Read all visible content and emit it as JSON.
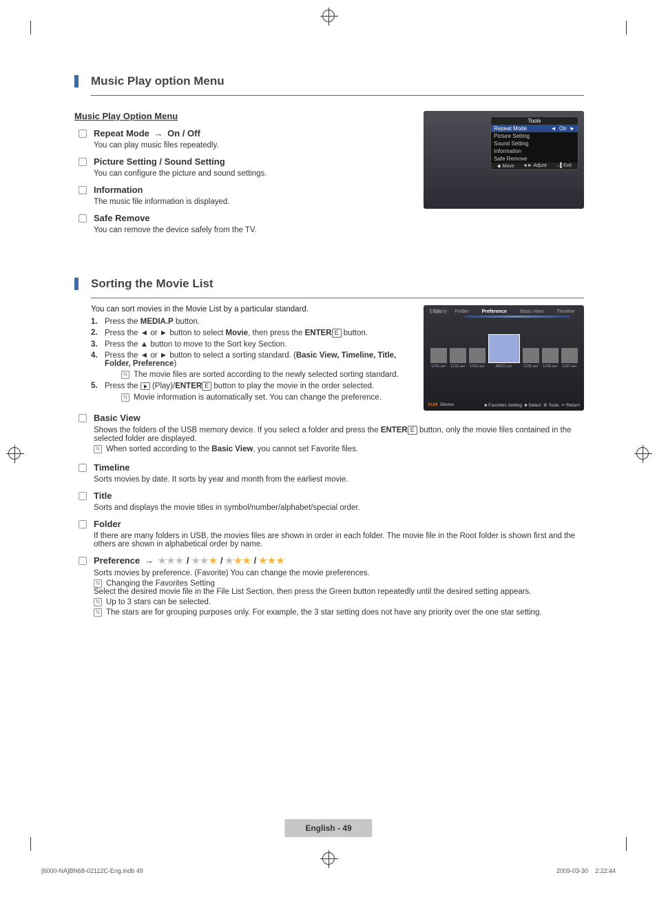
{
  "section1": {
    "heading": "Music Play option Menu",
    "subheading": "Music Play Option Menu",
    "items": [
      {
        "title_a": "Repeat Mode",
        "title_b": "On / Off",
        "desc": "You can play music files repeatedly."
      },
      {
        "title_a": "Picture Setting / Sound Setting",
        "desc": "You can configure the picture and sound settings."
      },
      {
        "title_a": "Information",
        "desc": "The music file information is displayed."
      },
      {
        "title_a": "Safe Remove",
        "desc": "You can remove the device safely from the TV."
      }
    ],
    "tools_panel": {
      "title": "Tools",
      "rows": [
        {
          "label": "Repeat Mode",
          "value": "On",
          "sel": true
        },
        {
          "label": "Picture Setting"
        },
        {
          "label": "Sound Setting"
        },
        {
          "label": "Information"
        },
        {
          "label": "Safe Remove"
        }
      ],
      "foot": [
        "Move",
        "Adjust",
        "Exit"
      ]
    }
  },
  "section2": {
    "heading": "Sorting the Movie List",
    "intro": "You can sort movies in the Movie List by a particular standard.",
    "steps": [
      {
        "n": "1.",
        "pre": "Press the ",
        "b1": "MEDIA.P",
        "post": " button."
      },
      {
        "n": "2.",
        "pre": "Press the ◄ or ► button to select ",
        "b1": "Movie",
        "mid": ", then press the ",
        "b2": "ENTER",
        "post": " button.",
        "enter": true
      },
      {
        "n": "3.",
        "pre": "Press the ▲ button to move to the Sort key Section."
      },
      {
        "n": "4.",
        "pre": "Press the ◄ or ► button to select a sorting standard. (",
        "b1": "Basic View, Timeline, Title, Folder, Preference",
        "post": ")",
        "note": "The movie files are sorted according to the newly selected sorting standard."
      },
      {
        "n": "5.",
        "pre": "Press the ",
        "play": true,
        "mid": " (Play)/",
        "b2": "ENTER",
        "post": " button to play the movie in the order selected.",
        "enter": true,
        "note": "Movie information is automatically set. You can change the preference."
      }
    ],
    "movie_panel": {
      "title": "Movie",
      "tabs": [
        "Title",
        "Folder",
        "Preference",
        "Basic View",
        "Timeline"
      ],
      "thumbs": [
        "1231.avi",
        "1232.avi",
        "1233.avi",
        "ABCD.avi",
        "1235.avi",
        "1236.avi",
        "1237.avi"
      ],
      "foot_left": [
        "SUM",
        "Device"
      ],
      "foot_right": [
        "Favorites Setting",
        "Select",
        "Tools",
        "Return"
      ]
    },
    "items": [
      {
        "title": "Basic View",
        "desc": "Shows the folders of the USB memory device. If you select a folder and press the ENTER button, only the movie files contained in the selected folder are displayed.",
        "enter_inline": true,
        "notes": [
          "When sorted according to the Basic View, you cannot set Favorite files."
        ],
        "bold_in_note": "Basic View"
      },
      {
        "title": "Timeline",
        "desc": "Sorts movies by date. It sorts by year and month from the earliest movie."
      },
      {
        "title": "Title",
        "desc": "Sorts and displays the movie titles in symbol/number/alphabet/special order."
      },
      {
        "title": "Folder",
        "desc": "If there are many folders in USB, the movies files are shown in order in each folder. The movie file in the Root folder is shown first and the others are shown in alphabetical order by name."
      },
      {
        "title": "Preference",
        "pref": true,
        "desc": "Sorts movies by preference. (Favorite) You can change the movie preferences.",
        "notes": [
          "Changing the Favorites Setting\nSelect the desired movie file in the File List Section, then press the Green button repeatedly until the desired setting appears.",
          "Up to 3 stars can be selected.",
          "The stars are for grouping purposes only. For example, the 3 star setting does not have any priority over the one star setting."
        ]
      }
    ]
  },
  "footer": {
    "page_label": "English - 49",
    "file_left": "[6000-NA]BN68-02112C-Eng.indb   49",
    "file_right": "2009-03-30      2:22:44"
  },
  "glyphs": {
    "arrow": "→",
    "star": "★",
    "note": "N",
    "enter": "E",
    "tri_l": "◄",
    "tri_r": "►",
    "diamond": "◆"
  }
}
